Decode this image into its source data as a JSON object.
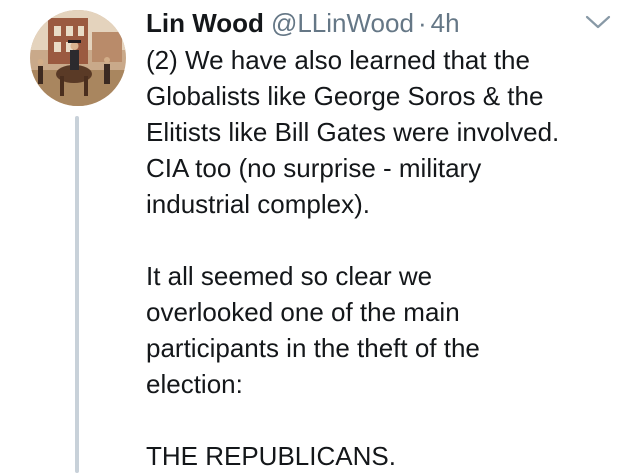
{
  "tweet": {
    "author_name": "Lin Wood",
    "handle": "@LLinWood",
    "separator": "·",
    "time": "4h",
    "avatar_icon": "painting-horseman-avatar",
    "caret_icon": "chevron-down-icon",
    "paragraphs": {
      "p1": [
        "(2) We have also learned that the",
        "Globalists like George Soros & the",
        "Elitists like Bill Gates were involved.",
        "CIA too (no surprise - military",
        "industrial complex)."
      ],
      "p2": [
        "It all seemed so clear we",
        "overlooked one of the main",
        "participants in the theft of the",
        "election:"
      ],
      "p3": [
        "THE REPUBLICANS."
      ]
    }
  },
  "colors": {
    "text": "#14171a",
    "secondary": "#657786",
    "thread_line": "#c8d1d9"
  }
}
